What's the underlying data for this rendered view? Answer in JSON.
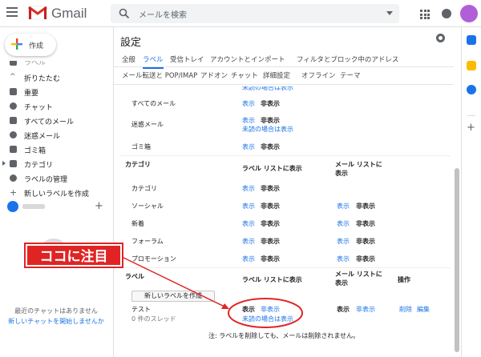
{
  "header": {
    "app_name": "Gmail",
    "search_placeholder": "メールを検索"
  },
  "sidebar": {
    "compose_label": "作成",
    "items": [
      {
        "label": "ラベル",
        "icon": "label-icon"
      },
      {
        "label": "折りたたむ",
        "icon": "chevron-up-icon"
      },
      {
        "label": "重要",
        "icon": "important-icon"
      },
      {
        "label": "チャット",
        "icon": "chat-icon"
      },
      {
        "label": "すべてのメール",
        "icon": "mail-icon"
      },
      {
        "label": "迷惑メール",
        "icon": "spam-icon"
      },
      {
        "label": "ゴミ箱",
        "icon": "trash-icon"
      },
      {
        "label": "カテゴリ",
        "icon": "label-icon"
      },
      {
        "label": "ラベルの管理",
        "icon": "gear-icon"
      },
      {
        "label": "新しいラベルを作成",
        "icon": "plus-icon"
      }
    ],
    "chat_empty": "最近のチャットはありません",
    "chat_start": "新しいチャットを開始しませんか"
  },
  "settings": {
    "title": "設定",
    "tabs_row1": [
      "全般",
      "ラベル",
      "受信トレイ",
      "アカウントとインポート",
      "フィルタとブロック中のアドレス"
    ],
    "tabs_row2": [
      "メール転送と POP/IMAP",
      "アドオン",
      "チャット",
      "詳細設定",
      "オフライン",
      "テーマ"
    ],
    "active_tab": "ラベル",
    "show": "表示",
    "hide": "非表示",
    "show_if_unread": "未読の場合は表示",
    "system_rows": [
      {
        "name": "すべてのメール"
      },
      {
        "name": "迷惑メール"
      },
      {
        "name": "ゴミ箱"
      }
    ],
    "categories_header": "カテゴリ",
    "label_list_header": "ラベル リストに表示",
    "message_list_header": "メール リストに表示",
    "actions_header": "操作",
    "category_rows": [
      {
        "name": "カテゴリ"
      },
      {
        "name": "ソーシャル"
      },
      {
        "name": "新着"
      },
      {
        "name": "フォーラム"
      },
      {
        "name": "プロモーション"
      }
    ],
    "labels_header": "ラベル",
    "new_label_button": "新しいラベルを作成",
    "user_label": {
      "name": "テスト",
      "threads": "0 件のスレッド",
      "remove": "削除",
      "edit": "編集"
    },
    "note": "注: ラベルを削除しても、メールは削除されません。"
  },
  "annotation": {
    "text": "ココに注目",
    "color": "#e02424"
  }
}
